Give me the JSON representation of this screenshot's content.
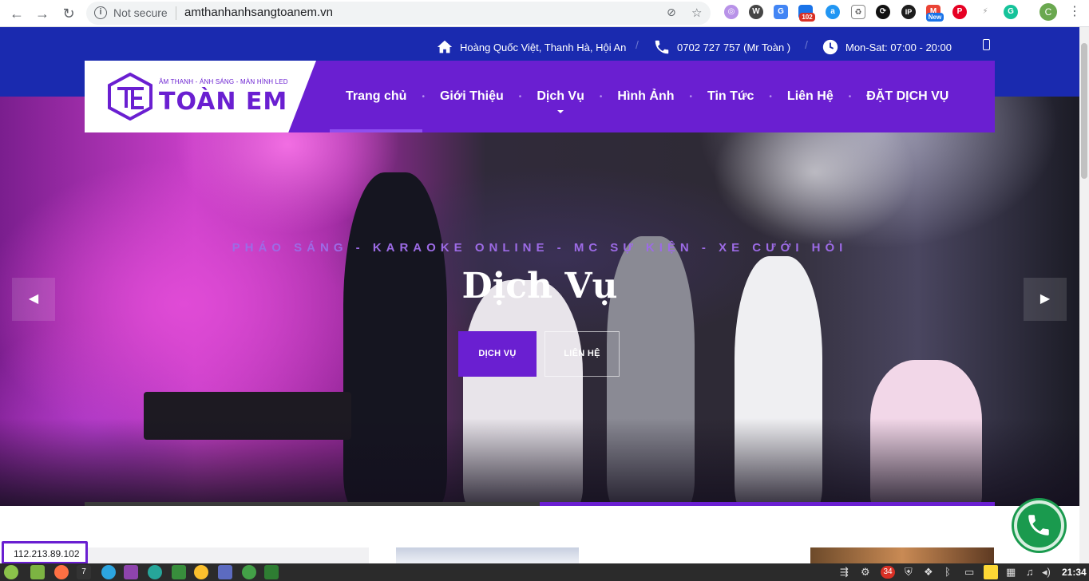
{
  "browser": {
    "security_label": "Not secure",
    "url": "amthanhanhsangtoanem.vn",
    "ext_badge_102": "102",
    "ext_badge_new": "New",
    "profile_initial": "C"
  },
  "topbar": {
    "address": "Hoàng Quốc Việt, Thanh Hà, Hội An",
    "phone": "0702 727 757 (Mr Toàn )",
    "hours": "Mon-Sat: 07:00 - 20:00"
  },
  "logo": {
    "tagline": "ÂM THANH - ÁNH SÁNG - MÀN HÌNH LED",
    "name": "TOÀN EM"
  },
  "nav": {
    "items": [
      {
        "label": "Trang chủ"
      },
      {
        "label": "Giới Thiệu"
      },
      {
        "label": "Dịch Vụ"
      },
      {
        "label": "Hình Ảnh"
      },
      {
        "label": "Tin Tức"
      },
      {
        "label": "Liên Hệ"
      },
      {
        "label": "ĐẶT DỊCH VỤ"
      }
    ],
    "active_index": 0
  },
  "hero": {
    "subtitle": "PHÁO SÁNG - KARAOKE ONLINE - MC SỰ KIỆN - XE CƯỚI HỎI",
    "title": "Dịch Vụ",
    "button_primary": "DỊCH VỤ",
    "button_secondary": "LIÊN HỆ",
    "slide_progress": 0.5
  },
  "status_bar": {
    "ip": "112.213.89.102"
  },
  "taskbar": {
    "clock": "21:34",
    "notification_count": "34",
    "workspace": "7"
  },
  "colors": {
    "brand_purple": "#6a1fd1",
    "topbar_blue": "#1a2aaf",
    "phone_green": "#1a9a4e"
  }
}
